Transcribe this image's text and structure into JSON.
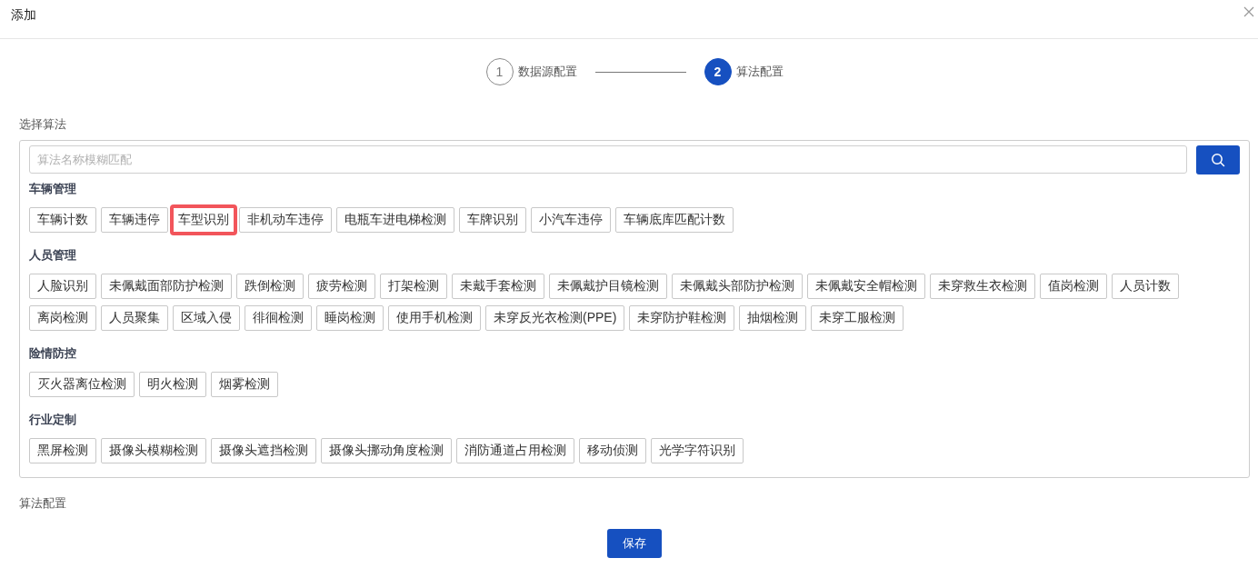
{
  "dialog": {
    "title": "添加"
  },
  "steps": [
    {
      "number": "1",
      "label": "数据源配置",
      "selected": false
    },
    {
      "number": "2",
      "label": "算法配置",
      "selected": true
    }
  ],
  "algorithm_section": {
    "label": "选择算法",
    "search": {
      "placeholder": "算法名称模糊匹配"
    },
    "groups": [
      {
        "title": "车辆管理",
        "items": [
          {
            "label": "车辆计数",
            "selected": false
          },
          {
            "label": "车辆违停",
            "selected": false
          },
          {
            "label": "车型识别",
            "selected": true
          },
          {
            "label": "非机动车违停",
            "selected": false
          },
          {
            "label": "电瓶车进电梯检测",
            "selected": false
          },
          {
            "label": "车牌识别",
            "selected": false
          },
          {
            "label": "小汽车违停",
            "selected": false
          },
          {
            "label": "车辆底库匹配计数",
            "selected": false
          }
        ]
      },
      {
        "title": "人员管理",
        "items": [
          {
            "label": "人脸识别",
            "selected": false
          },
          {
            "label": "未佩戴面部防护检测",
            "selected": false
          },
          {
            "label": "跌倒检测",
            "selected": false
          },
          {
            "label": "疲劳检测",
            "selected": false
          },
          {
            "label": "打架检测",
            "selected": false
          },
          {
            "label": "未戴手套检测",
            "selected": false
          },
          {
            "label": "未佩戴护目镜检测",
            "selected": false
          },
          {
            "label": "未佩戴头部防护检测",
            "selected": false
          },
          {
            "label": "未佩戴安全帽检测",
            "selected": false
          },
          {
            "label": "未穿救生衣检测",
            "selected": false
          },
          {
            "label": "值岗检测",
            "selected": false
          },
          {
            "label": "人员计数",
            "selected": false
          },
          {
            "label": "离岗检测",
            "selected": false
          },
          {
            "label": "人员聚集",
            "selected": false
          },
          {
            "label": "区域入侵",
            "selected": false
          },
          {
            "label": "徘徊检测",
            "selected": false
          },
          {
            "label": "睡岗检测",
            "selected": false
          },
          {
            "label": "使用手机检测",
            "selected": false
          },
          {
            "label": "未穿反光衣检测(PPE)",
            "selected": false
          },
          {
            "label": "未穿防护鞋检测",
            "selected": false
          },
          {
            "label": "抽烟检测",
            "selected": false
          },
          {
            "label": "未穿工服检测",
            "selected": false
          }
        ]
      },
      {
        "title": "险情防控",
        "items": [
          {
            "label": "灭火器离位检测",
            "selected": false
          },
          {
            "label": "明火检测",
            "selected": false
          },
          {
            "label": "烟雾检测",
            "selected": false
          }
        ]
      },
      {
        "title": "行业定制",
        "items": [
          {
            "label": "黑屏检测",
            "selected": false
          },
          {
            "label": "摄像头模糊检测",
            "selected": false
          },
          {
            "label": "摄像头遮挡检测",
            "selected": false
          },
          {
            "label": "摄像头挪动角度检测",
            "selected": false
          },
          {
            "label": "消防通道占用检测",
            "selected": false
          },
          {
            "label": "移动侦测",
            "selected": false
          },
          {
            "label": "光学字符识别",
            "selected": false
          }
        ]
      }
    ]
  },
  "config_section": {
    "label": "算法配置"
  },
  "buttons": [
    {
      "label": "保存"
    }
  ]
}
